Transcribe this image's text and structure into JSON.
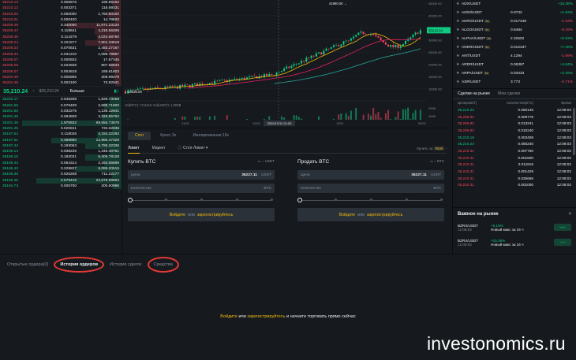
{
  "orderbook": {
    "asks": [
      {
        "price": "35210.13",
        "qty": "0.005676",
        "total": "199.85162",
        "depth": 0.08
      },
      {
        "price": "35210.12",
        "qty": "0.003371",
        "total": "118.69331",
        "depth": 0.06
      },
      {
        "price": "35210.02",
        "qty": "0.050000",
        "total": "1,760.50100",
        "depth": 0.12
      },
      {
        "price": "35210.01",
        "qty": "0.000420",
        "total": "14.78820",
        "depth": 0.05
      },
      {
        "price": "35209.48",
        "qty": "0.340000",
        "total": "11,971.23120",
        "depth": 0.45
      },
      {
        "price": "35209.47",
        "qty": "0.119841",
        "total": "4,219.56206",
        "depth": 0.22
      },
      {
        "price": "35208.46",
        "qty": "0.114279",
        "total": "4,023.58760",
        "depth": 0.2
      },
      {
        "price": "35208.24",
        "qty": "0.221577",
        "total": "7,801.33619",
        "depth": 0.3
      },
      {
        "price": "35208.23",
        "qty": "0.070531",
        "total": "2,483.27167",
        "depth": 0.14
      },
      {
        "price": "35206.34",
        "qty": "0.031210",
        "total": "1,098.78987",
        "depth": 0.1
      },
      {
        "price": "35206.07",
        "qty": "0.000502",
        "total": "17.67345",
        "depth": 0.05
      },
      {
        "price": "35205.08",
        "qty": "0.022939",
        "total": "807.56933",
        "depth": 0.09
      },
      {
        "price": "35205.07",
        "qty": "0.004818",
        "total": "169.61803",
        "depth": 0.06
      },
      {
        "price": "35204.49",
        "qty": "0.005965",
        "total": "209.99478",
        "depth": 0.06
      },
      {
        "price": "35204.48",
        "qty": "0.002100",
        "total": "73.92941",
        "depth": 0.05
      }
    ],
    "last_price": "35,210.24",
    "last_arrow": "↑",
    "last_usd": "$35,210.24",
    "more_label": "Больше",
    "bids": [
      {
        "price": "35202.17",
        "qty": "0.046268",
        "total": "1,628.73458",
        "depth": 0.1
      },
      {
        "price": "35201.56",
        "qty": "0.076409",
        "total": "2,689.71600",
        "depth": 0.14
      },
      {
        "price": "35201.50",
        "qty": "0.032275",
        "total": "1,136.12841",
        "depth": 0.09
      },
      {
        "price": "35201.49",
        "qty": "0.094509",
        "total": "3,326.85762",
        "depth": 0.16
      },
      {
        "price": "35201.48",
        "qty": "1.975932",
        "total": "69,555.73578",
        "depth": 0.82
      },
      {
        "price": "35201.25",
        "qty": "0.020841",
        "total": "733.62935",
        "depth": 0.08
      },
      {
        "price": "35197.52",
        "qty": "0.118026",
        "total": "4,154.22250",
        "depth": 0.2
      },
      {
        "price": "35197.51",
        "qty": "0.368960",
        "total": "12,986.47329",
        "depth": 0.58
      },
      {
        "price": "35197.44",
        "qty": "0.193063",
        "total": "6,795.32336",
        "depth": 0.3
      },
      {
        "price": "35196.14",
        "qty": "0.038226",
        "total": "1,345.40761",
        "depth": 0.1
      },
      {
        "price": "35196.10",
        "qty": "0.182031",
        "total": "6,406.78128",
        "depth": 0.3
      },
      {
        "price": "35195.43",
        "qty": "0.064314",
        "total": "2,263.55889",
        "depth": 0.14
      },
      {
        "price": "35195.42",
        "qty": "0.229837",
        "total": "8,089.20515",
        "depth": 0.38
      },
      {
        "price": "35195.36",
        "qty": "0.020208",
        "total": "711.22177",
        "depth": 0.08
      },
      {
        "price": "35195.35",
        "qty": "0.678419",
        "total": "23,876.99963",
        "depth": 0.7
      },
      {
        "price": "35194.73",
        "qty": "0.005700",
        "total": "200.60996",
        "depth": 0.07
      }
    ]
  },
  "chart": {
    "price_tag": "35210.24",
    "high_label": "41950.00 →",
    "low_label": "← 10620.00",
    "price_axis": [
      "45000.00",
      "40000.00",
      "35000.00",
      "30000.00",
      "25000.00",
      "20000.00",
      "15000.00",
      "10000.00"
    ],
    "vol_label": "Vol(BTC): 72.611K  Vol(USDT): 1.005B",
    "vol_axis": [
      "200K",
      "100K",
      "50K"
    ],
    "time_axis": [
      "11/01",
      "12/01",
      "2021",
      "02/01"
    ],
    "crosshair_time": "2020/12/11 01:00"
  },
  "trade": {
    "tabs": [
      "Спот",
      "Кросс 3x",
      "Изолированная 10x"
    ],
    "order_types": [
      "Лимит",
      "Маркет",
      "Стоп-Лимит ▾"
    ],
    "buy_to_label": "Купить за",
    "buy_to_currency": "RUB",
    "buy": {
      "title": "Купить BTC",
      "avail": "– USDT",
      "price_label": "Цена",
      "price": "35227.11",
      "price_unit": "USDT",
      "qty_label": "Количество",
      "qty_unit": "BTC"
    },
    "sell": {
      "title": "Продать BTC",
      "avail": "– BTC",
      "price_label": "Цена",
      "price": "35227.11",
      "price_unit": "USDT",
      "qty_label": "Количество",
      "qty_unit": "BTC"
    },
    "login": {
      "login": "Войдите",
      "or": "или",
      "register": "зарегистрируйтесь"
    }
  },
  "markets": [
    {
      "pair": "ADX/USDT",
      "lev": "",
      "price": "",
      "chg": "+18.38%",
      "up": true
    },
    {
      "pair": "AION/USDT",
      "lev": "",
      "price": "0.0732",
      "chg": "+1.52%",
      "up": true
    },
    {
      "pair": "AKRO/USDT",
      "lev": "5x",
      "price": "0.017448",
      "chg": "-1.23%",
      "up": false
    },
    {
      "pair": "ALGO/USDT",
      "lev": "5x",
      "price": "0.6484",
      "chg": "-0.29%",
      "up": false
    },
    {
      "pair": "ALPHA/USDT",
      "lev": "5x",
      "price": "2.32502",
      "chg": "+6.02%",
      "up": true
    },
    {
      "pair": "ANKR/USDT",
      "lev": "5x",
      "price": "0.012437",
      "chg": "+7.46%",
      "up": true
    },
    {
      "pair": "ANT/USDT",
      "lev": "",
      "price": "4.1294",
      "chg": "-2.89%",
      "up": false
    },
    {
      "pair": "ARDR/USDT",
      "lev": "",
      "price": "0.08387",
      "chg": "+4.84%",
      "up": true
    },
    {
      "pair": "ARPA/USDT",
      "lev": "5x",
      "price": "0.03434",
      "chg": "+2.25%",
      "up": true
    },
    {
      "pair": "ASR/USDT",
      "lev": "",
      "price": "3.773",
      "chg": "-0.71%",
      "up": false
    }
  ],
  "trades": {
    "tabs": [
      "Сделки на рынке",
      "Мои сделки"
    ],
    "headers": [
      "Цена(USDT)",
      "Количество(BTC)",
      "Время"
    ],
    "rows": [
      {
        "p": "35,210.24",
        "q": "0.060145",
        "t": "12:08:03",
        "up": true
      },
      {
        "p": "35,206.82",
        "q": "0.009778",
        "t": "12:08:03",
        "up": false
      },
      {
        "p": "35,206.82",
        "q": "0.013241",
        "t": "12:08:03",
        "up": false
      },
      {
        "p": "35,206.83",
        "q": "0.010240",
        "t": "12:08:03",
        "up": false
      },
      {
        "p": "35,210.19",
        "q": "0.003408",
        "t": "12:08:03",
        "up": true
      },
      {
        "p": "35,210.23",
        "q": "0.060240",
        "t": "12:08:03",
        "up": true
      },
      {
        "p": "35,210.31",
        "q": "0.007750",
        "t": "12:08:02",
        "up": false
      },
      {
        "p": "35,210.31",
        "q": "0.001500",
        "t": "12:08:02",
        "up": false
      },
      {
        "p": "35,210.31",
        "q": "0.011919",
        "t": "12:08:02",
        "up": false
      },
      {
        "p": "35,210.31",
        "q": "0.001429",
        "t": "12:08:02",
        "up": false
      },
      {
        "p": "35,210.31",
        "q": "0.025666",
        "t": "12:08:02",
        "up": false
      },
      {
        "p": "35,210.31",
        "q": "0.001000",
        "t": "12:08:02",
        "up": false
      }
    ]
  },
  "important": {
    "title": "Важное на рынке",
    "rows": [
      {
        "pair": "BZRX/USDT",
        "time": "12:08:02",
        "chg": "+5.16%",
        "msg": "Новый макс за 24 ч",
        "badge": "~A~"
      },
      {
        "pair": "BZRX/USDT",
        "time": "12:08:02",
        "chg": "+15.36%",
        "msg": "Новый макс за 24 ч",
        "badge": "~~~"
      }
    ]
  },
  "bottom": {
    "tabs": [
      "Открытые ордера(0)",
      "История ордеров",
      "История сделок",
      "Средства"
    ],
    "login": "Войдите",
    "or": "или",
    "register": "зарегистрируйтесь",
    "suffix": "и начните торговать прямо сейчас"
  },
  "watermark": "investonomics.ru",
  "colors": {
    "up": "#0ecb81",
    "down": "#f6465d",
    "accent": "#f0b90b",
    "highlight": "#e53935"
  }
}
